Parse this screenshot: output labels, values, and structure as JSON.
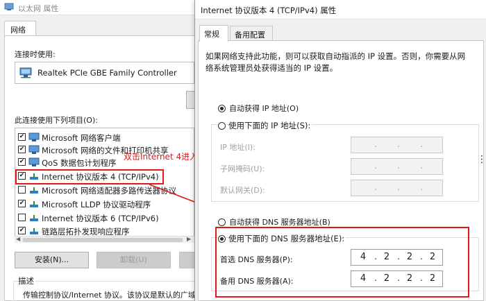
{
  "bg_window": {
    "title": "以太网 属性",
    "tab": "网络",
    "connect_using_label": "连接时使用:",
    "adapter_name": "Realtek PCIe GBE Family Controller",
    "items_label": "此连接使用下列项目(O):",
    "items": [
      {
        "label": "Microsoft 网络客户端",
        "checked": true,
        "icon": "network-client-icon"
      },
      {
        "label": "Microsoft 网络的文件和打印机共享",
        "checked": true,
        "icon": "file-share-icon"
      },
      {
        "label": "QoS 数据包计划程序",
        "checked": true,
        "icon": "qos-icon"
      },
      {
        "label": "Internet 协议版本 4 (TCP/IPv4)",
        "checked": true,
        "icon": "protocol-icon"
      },
      {
        "label": "Microsoft 网络适配器多路传送器协议",
        "checked": false,
        "icon": "protocol-icon"
      },
      {
        "label": "Microsoft LLDP 协议驱动程序",
        "checked": true,
        "icon": "protocol-icon"
      },
      {
        "label": "Internet 协议版本 6 (TCP/IPv6)",
        "checked": false,
        "icon": "protocol-icon"
      },
      {
        "label": "链路层拓扑发现响应程序",
        "checked": true,
        "icon": "protocol-icon"
      }
    ],
    "install_button": "安装(N)...",
    "uninstall_button": "卸载(U)",
    "description_label": "描述",
    "description_text": "传输控制协议/Internet 协议。该协议是默认的广域"
  },
  "annotation": {
    "text": "双击Internet 4进入",
    "color": "#e01818"
  },
  "dialog": {
    "title": "Internet 协议版本 4 (TCP/IPv4) 属性",
    "tabs": [
      "常规",
      "备用配置"
    ],
    "active_tab": "常规",
    "intro_line1": "如果网络支持此功能，则可以获取自动指派的 IP 设置。否则，你需要从网",
    "intro_line2": "络系统管理员处获得适当的 IP 设置。",
    "auto_ip_label": "自动获得 IP 地址(O)",
    "manual_ip_label": "使用下面的 IP 地址(S):",
    "ip_address_label": "IP 地址(I):",
    "subnet_label": "子网掩码(U):",
    "gateway_label": "默认网关(D):",
    "auto_dns_label": "自动获得 DNS 服务器地址(B)",
    "manual_dns_label": "使用下面的 DNS 服务器地址(E):",
    "preferred_dns_label": "首选 DNS 服务器(P):",
    "alternate_dns_label": "备用 DNS 服务器(A):",
    "preferred_dns": [
      "4",
      "2",
      "2",
      "2"
    ],
    "alternate_dns": [
      "4",
      "2",
      "2",
      "2"
    ],
    "dot": "."
  }
}
